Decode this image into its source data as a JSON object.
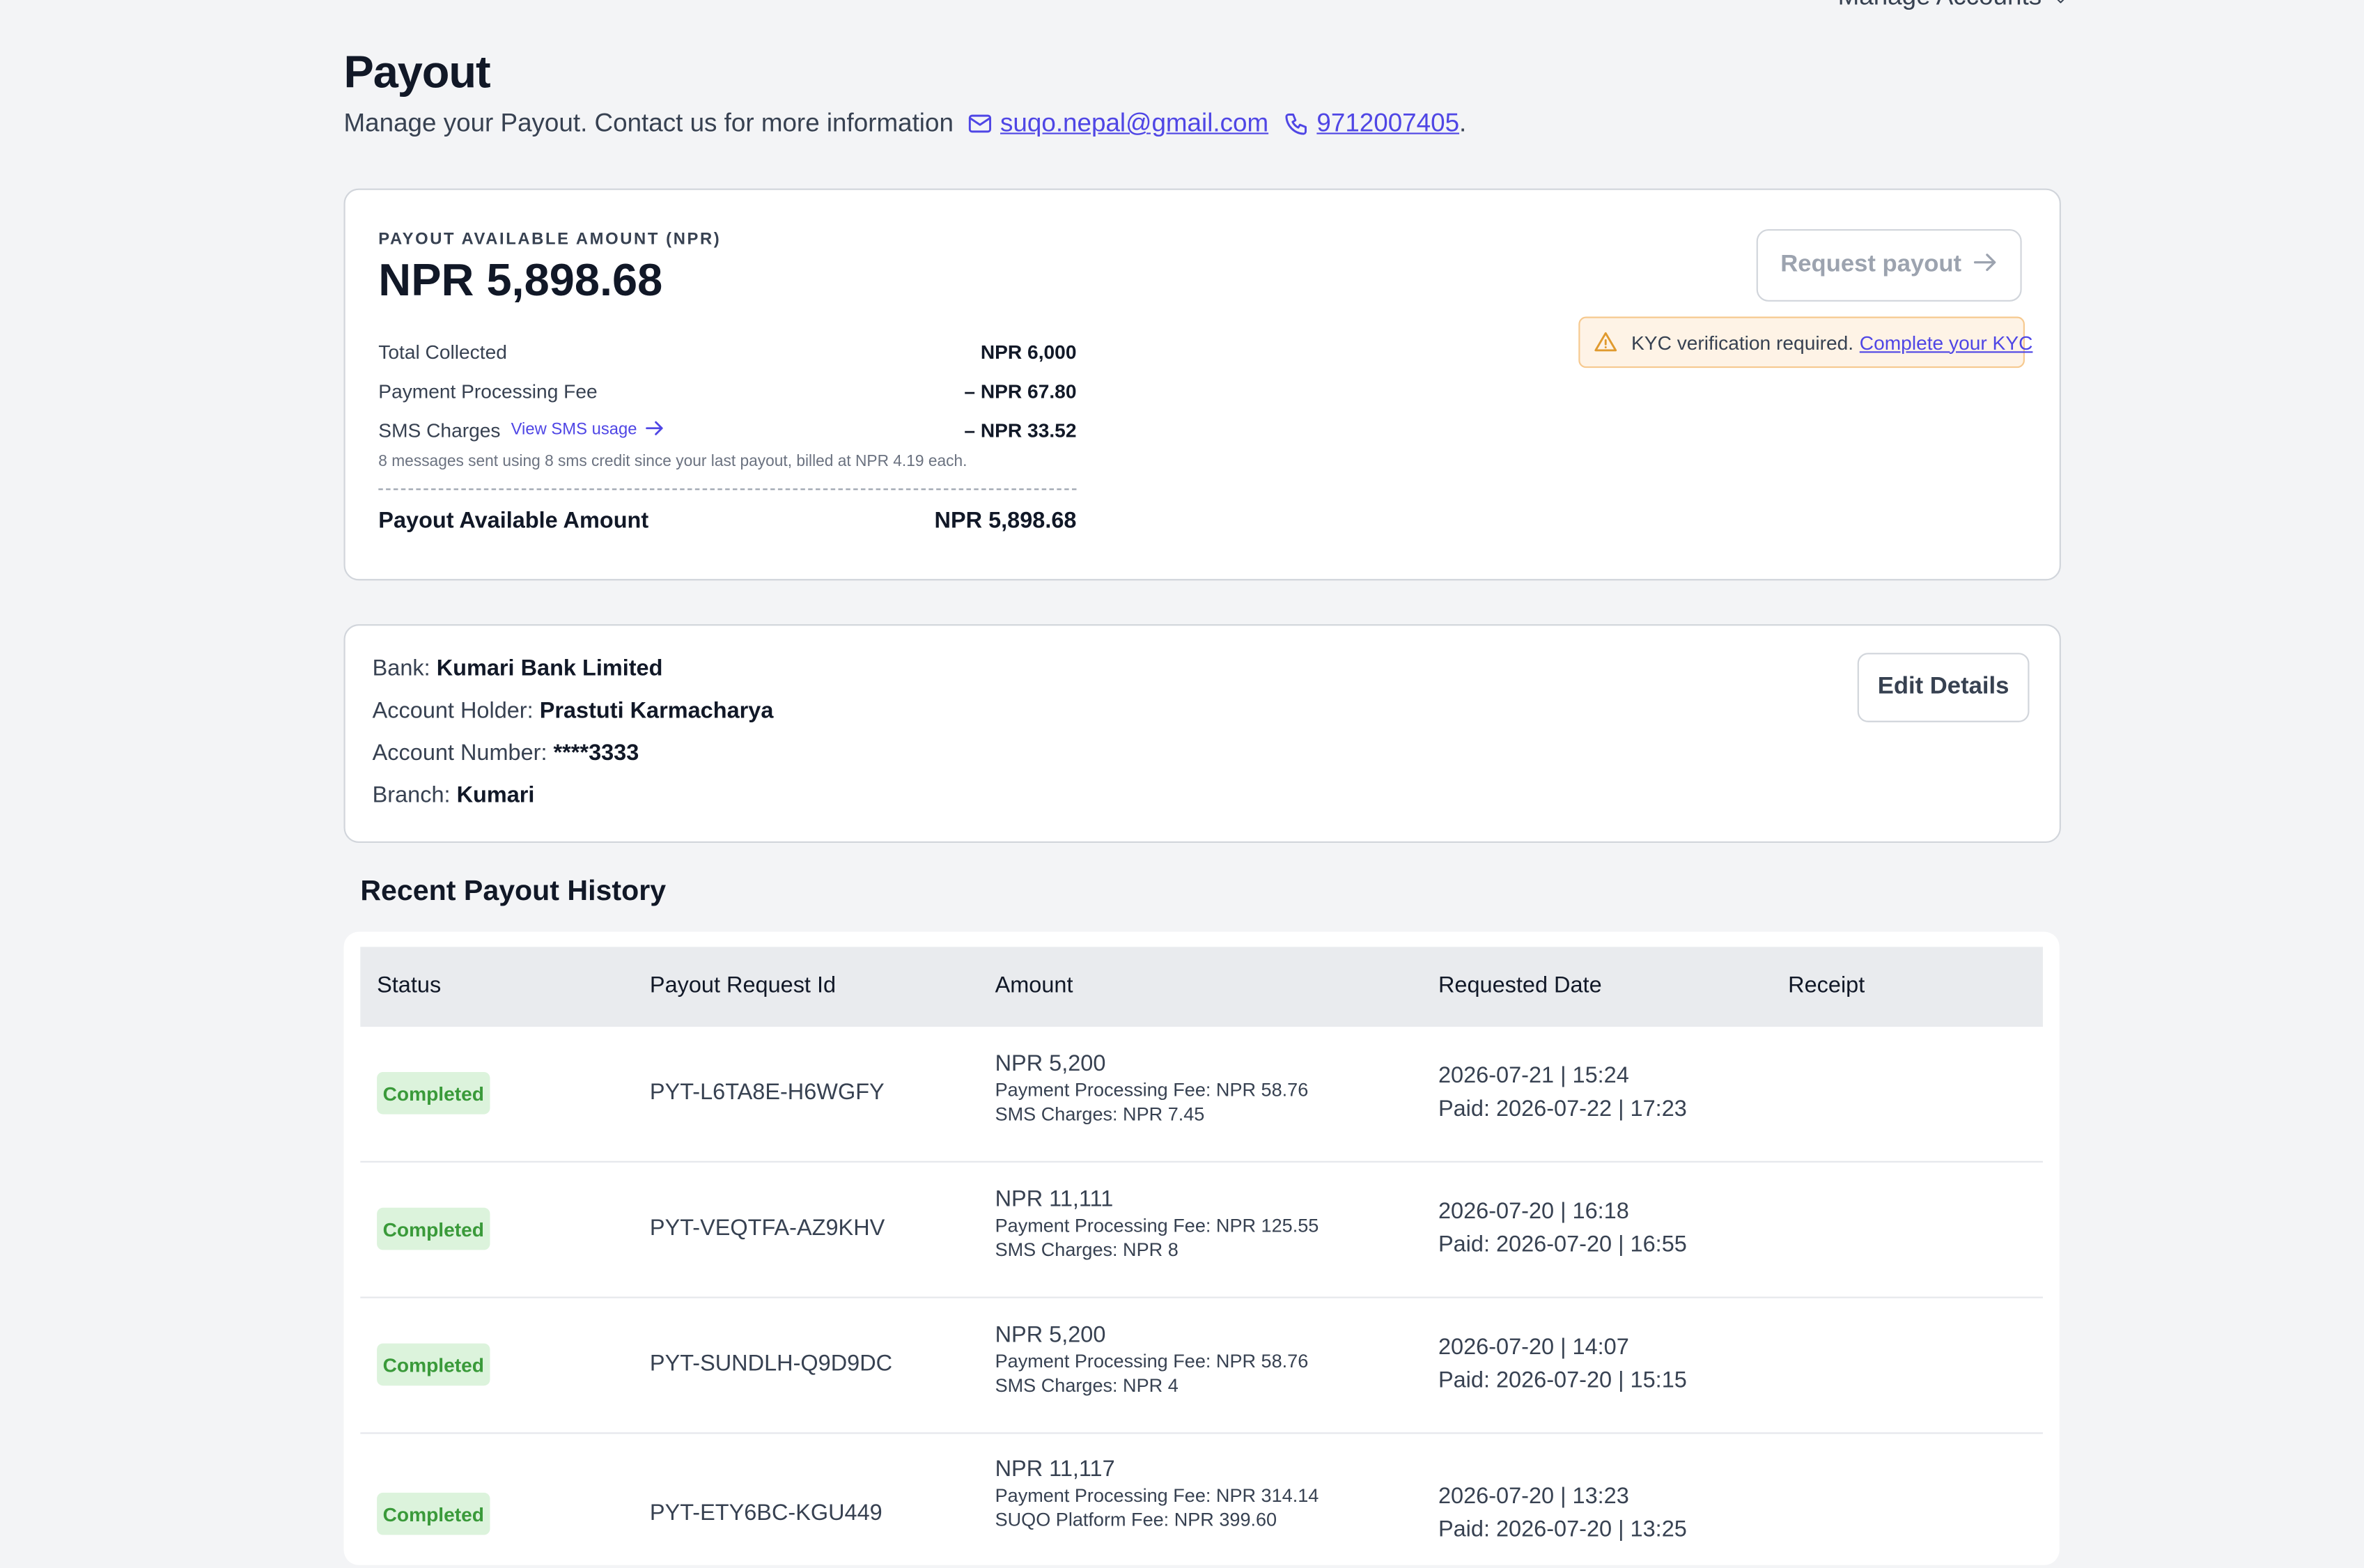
{
  "header": {
    "manage_accounts": "Manage Accounts",
    "title": "Payout",
    "subtitle": "Manage your Payout. Contact us for more information",
    "email": "suqo.nepal@gmail.com",
    "phone": "9712007405",
    "period": "."
  },
  "summary": {
    "caption": "PAYOUT AVAILABLE AMOUNT (NPR)",
    "amount": "NPR 5,898.68",
    "total_collected_label": "Total Collected",
    "total_collected_value": "NPR 6,000",
    "processing_fee_label": "Payment Processing Fee",
    "processing_fee_value": "– NPR 67.80",
    "sms_label": "SMS Charges",
    "sms_link": "View SMS usage",
    "sms_value": "– NPR 33.52",
    "sms_note": "8 messages sent using 8 sms credit since your last payout, billed at NPR 4.19 each.",
    "available_label": "Payout Available Amount",
    "available_value": "NPR 5,898.68",
    "request_button": "Request payout",
    "kyc_text": "KYC verification required.",
    "kyc_link": "Complete your KYC"
  },
  "bank": {
    "bank_label": "Bank:",
    "bank_value": "Kumari Bank Limited",
    "holder_label": "Account Holder:",
    "holder_value": "Prastuti Karmacharya",
    "number_label": "Account Number:",
    "number_value": "****3333",
    "branch_label": "Branch:",
    "branch_value": "Kumari",
    "edit_button": "Edit Details"
  },
  "history": {
    "title": "Recent Payout History",
    "columns": [
      "Status",
      "Payout Request Id",
      "Amount",
      "Requested Date",
      "Receipt"
    ],
    "rows": [
      {
        "status": "Completed",
        "id": "PYT-L6TA8E-H6WGFY",
        "amount": "NPR 5,200",
        "fee_line": "Payment Processing Fee: NPR 58.76",
        "extra_line": "SMS Charges: NPR 7.45",
        "requested": "2026-07-21 | 15:24",
        "paid": "Paid: 2026-07-22 | 17:23"
      },
      {
        "status": "Completed",
        "id": "PYT-VEQTFA-AZ9KHV",
        "amount": "NPR 11,111",
        "fee_line": "Payment Processing Fee: NPR 125.55",
        "extra_line": "SMS Charges: NPR 8",
        "requested": "2026-07-20 | 16:18",
        "paid": "Paid: 2026-07-20 | 16:55"
      },
      {
        "status": "Completed",
        "id": "PYT-SUNDLH-Q9D9DC",
        "amount": "NPR 5,200",
        "fee_line": "Payment Processing Fee: NPR 58.76",
        "extra_line": "SMS Charges: NPR 4",
        "requested": "2026-07-20 | 14:07",
        "paid": "Paid: 2026-07-20 | 15:15"
      },
      {
        "status": "Completed",
        "id": "PYT-ETY6BC-KGU449",
        "amount": "NPR 11,117",
        "fee_line": "Payment Processing Fee: NPR 314.14",
        "extra_line": "SUQO Platform Fee: NPR 399.60",
        "requested": "2026-07-20 | 13:23",
        "paid": "Paid: 2026-07-20 | 13:25"
      }
    ]
  },
  "colors": {
    "accent": "#4f46e5",
    "badge_bg": "#dcf3dc",
    "badge_text": "#3a9a3a",
    "kyc_bg": "#fef3e6",
    "kyc_border": "#f6c98f"
  }
}
